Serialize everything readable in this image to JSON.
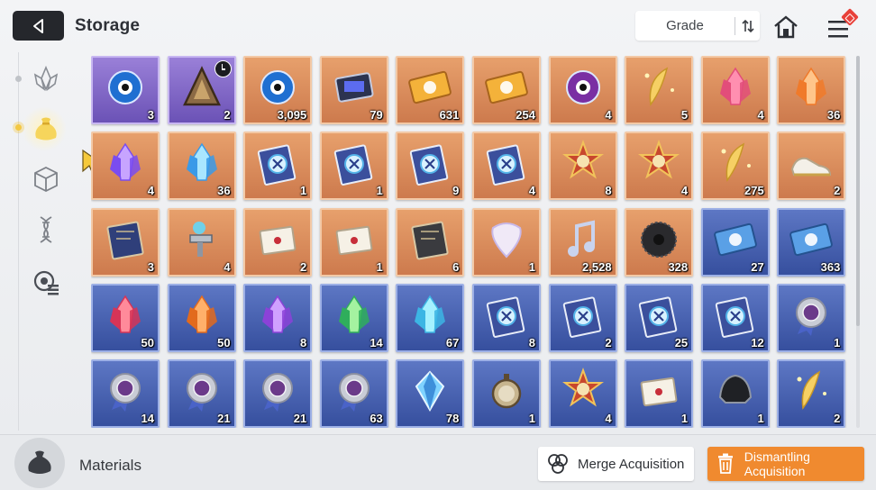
{
  "header": {
    "title": "Storage",
    "sort_label": "Grade"
  },
  "sidebar": {
    "tabs": [
      {
        "icon": "crystal-flower-icon",
        "active": false
      },
      {
        "icon": "material-bag-icon",
        "active": true
      },
      {
        "icon": "cube-icon",
        "active": false
      },
      {
        "icon": "dna-icon",
        "active": false
      },
      {
        "icon": "gear-list-icon",
        "active": false
      }
    ]
  },
  "colors": {
    "orange": "#d98a5a",
    "purple": "#7f66c6",
    "blue": "#4660b0",
    "accent": "#f08a2f"
  },
  "items": [
    {
      "grade": "purple",
      "icon": "eye-card-icon",
      "count": "3"
    },
    {
      "grade": "purple",
      "icon": "triangle-artifact-icon",
      "count": "2",
      "timed": true
    },
    {
      "grade": "orange",
      "icon": "blue-eye-orb-icon",
      "count": "3,095"
    },
    {
      "grade": "orange",
      "icon": "chip-panel-icon",
      "count": "79"
    },
    {
      "grade": "orange",
      "icon": "gold-ticket-icon",
      "count": "631"
    },
    {
      "grade": "orange",
      "icon": "gold-pass-icon",
      "count": "254"
    },
    {
      "grade": "orange",
      "icon": "purple-eye-orb-icon",
      "count": "4"
    },
    {
      "grade": "orange",
      "icon": "gold-feather-icon",
      "count": "5"
    },
    {
      "grade": "orange",
      "icon": "pink-crystal-icon",
      "count": "4"
    },
    {
      "grade": "orange",
      "icon": "orange-crystal-icon",
      "count": "36"
    },
    {
      "grade": "orange",
      "icon": "violet-crystal-icon",
      "count": "4"
    },
    {
      "grade": "orange",
      "icon": "blue-crystal-icon",
      "count": "36"
    },
    {
      "grade": "orange",
      "icon": "cross-manual-icon",
      "count": "1"
    },
    {
      "grade": "orange",
      "icon": "shield-manual-icon",
      "count": "1"
    },
    {
      "grade": "orange",
      "icon": "eye-manual-icon",
      "count": "9"
    },
    {
      "grade": "orange",
      "icon": "star-manual-icon",
      "count": "4"
    },
    {
      "grade": "orange",
      "icon": "sun-emblem-icon",
      "count": "8"
    },
    {
      "grade": "orange",
      "icon": "sun-emblem-alt-icon",
      "count": "4"
    },
    {
      "grade": "orange",
      "icon": "gold-shards-icon",
      "count": "275"
    },
    {
      "grade": "orange",
      "icon": "sneakers-icon",
      "count": "2"
    },
    {
      "grade": "orange",
      "icon": "star-map-book-icon",
      "count": "3"
    },
    {
      "grade": "orange",
      "icon": "spray-gun-icon",
      "count": "4"
    },
    {
      "grade": "orange",
      "icon": "playing-cards-icon",
      "count": "2"
    },
    {
      "grade": "orange",
      "icon": "sealed-letter-icon",
      "count": "1"
    },
    {
      "grade": "orange",
      "icon": "dark-tome-icon",
      "count": "6"
    },
    {
      "grade": "orange",
      "icon": "guitar-pick-icon",
      "count": "1"
    },
    {
      "grade": "orange",
      "icon": "music-note-icon",
      "count": "2,528"
    },
    {
      "grade": "orange",
      "icon": "black-flower-icon",
      "count": "328"
    },
    {
      "grade": "blue",
      "icon": "blue-ticket-icon",
      "count": "27"
    },
    {
      "grade": "blue",
      "icon": "blue-pass-icon",
      "count": "363"
    },
    {
      "grade": "blue",
      "icon": "red-crystal-icon",
      "count": "50"
    },
    {
      "grade": "blue",
      "icon": "amber-crystal-icon",
      "count": "50"
    },
    {
      "grade": "blue",
      "icon": "purple-crystal-icon",
      "count": "8"
    },
    {
      "grade": "blue",
      "icon": "green-crystal-icon",
      "count": "14"
    },
    {
      "grade": "blue",
      "icon": "cyan-crystal-icon",
      "count": "67"
    },
    {
      "grade": "blue",
      "icon": "cross-manual-icon",
      "count": "8"
    },
    {
      "grade": "blue",
      "icon": "shield-manual-icon",
      "count": "2"
    },
    {
      "grade": "blue",
      "icon": "eye-manual-icon",
      "count": "25"
    },
    {
      "grade": "blue",
      "icon": "star-manual-icon",
      "count": "12"
    },
    {
      "grade": "blue",
      "icon": "medal-icon",
      "count": "1"
    },
    {
      "grade": "blue",
      "icon": "medal-eye-icon",
      "count": "14"
    },
    {
      "grade": "blue",
      "icon": "medal-cross-icon",
      "count": "21"
    },
    {
      "grade": "blue",
      "icon": "medal-star-icon",
      "count": "21"
    },
    {
      "grade": "blue",
      "icon": "medal-circle-icon",
      "count": "63"
    },
    {
      "grade": "blue",
      "icon": "blue-gem-icon",
      "count": "78"
    },
    {
      "grade": "blue",
      "icon": "pocket-watch-icon",
      "count": "1"
    },
    {
      "grade": "blue",
      "icon": "red-star-badge-icon",
      "count": "4"
    },
    {
      "grade": "blue",
      "icon": "paper-scroll-icon",
      "count": "1"
    },
    {
      "grade": "blue",
      "icon": "black-helmet-icon",
      "count": "1"
    },
    {
      "grade": "blue",
      "icon": "sparkler-icon",
      "count": "2"
    }
  ],
  "footer": {
    "category_icon": "material-bag-icon",
    "category_label": "Materials",
    "merge_label": "Merge Acquisition",
    "dismantle_label": "Dismantling Acquisition"
  }
}
